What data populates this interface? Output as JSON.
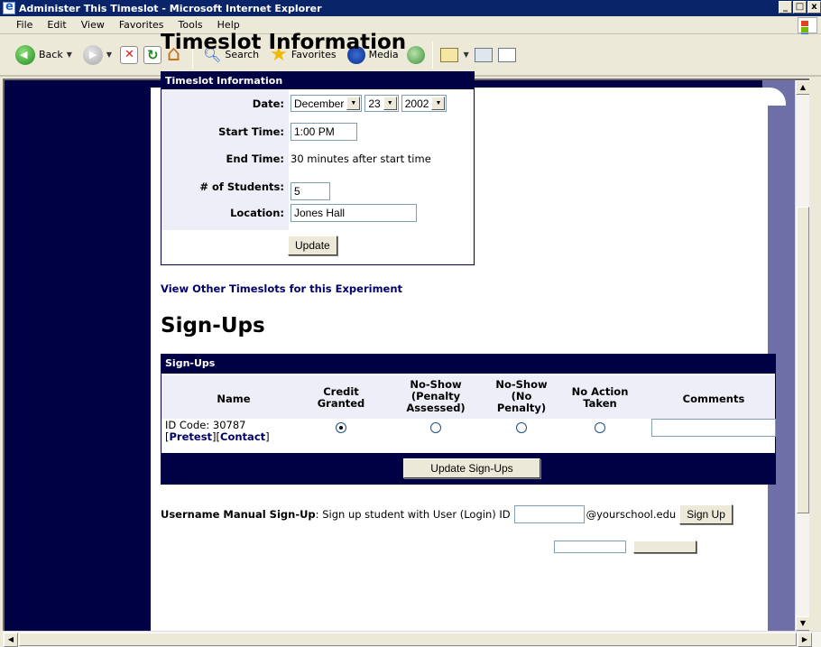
{
  "window": {
    "title": "Administer This Timeslot - Microsoft Internet Explorer",
    "controls": [
      "_",
      "□",
      "x"
    ]
  },
  "menu": [
    "File",
    "Edit",
    "View",
    "Favorites",
    "Tools",
    "Help"
  ],
  "toolbar": {
    "back": "Back",
    "search": "Search",
    "favorites": "Favorites",
    "media": "Media"
  },
  "page": {
    "title": "Timeslot Information",
    "timeslot_table": {
      "header": "Timeslot Information",
      "date_label": "Date:",
      "date_month": "December",
      "date_day": "23",
      "date_year": "2002",
      "start_label": "Start Time:",
      "start_value": "1:00 PM",
      "end_label": "End Time:",
      "end_value": "30 minutes after start time",
      "students_label": "# of Students:",
      "students_value": "5",
      "location_label": "Location:",
      "location_value": "Jones Hall",
      "update_button": "Update"
    },
    "view_other_link": "View Other Timeslots for this Experiment",
    "signups_title": "Sign-Ups",
    "signups_table": {
      "header": "Sign-Ups",
      "columns": {
        "name": "Name",
        "credit": [
          "Credit",
          "Granted"
        ],
        "noshow_penalty": [
          "No-Show",
          "(Penalty",
          "Assessed)"
        ],
        "noshow_nopenalty": [
          "No-Show",
          "(No",
          "Penalty)"
        ],
        "no_action": [
          "No Action",
          "Taken"
        ],
        "comments": "Comments"
      },
      "row": {
        "id_code": "ID Code: 30787",
        "pretest": "Pretest",
        "contact": "Contact",
        "selected": "credit"
      },
      "update_button": "Update Sign-Ups"
    },
    "manual_signup": {
      "label": "Username Manual Sign-Up",
      "text": ": Sign up student with User (Login) ID",
      "domain": "@yourschool.edu",
      "button": "Sign Up"
    }
  }
}
